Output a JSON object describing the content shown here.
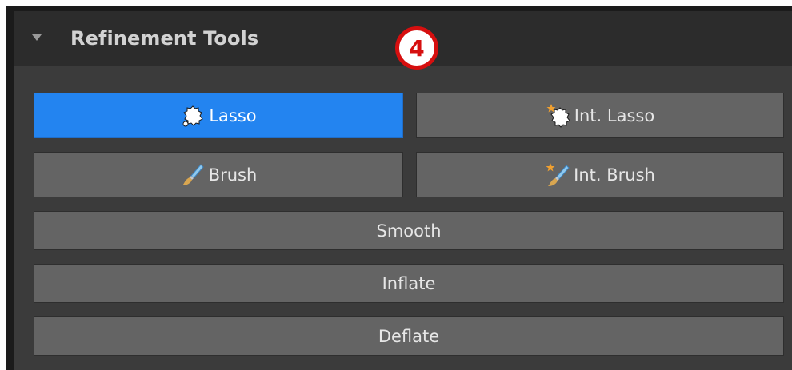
{
  "panel": {
    "title": "Refinement Tools",
    "step_badge": "4"
  },
  "tools": {
    "lasso": {
      "label": "Lasso",
      "icon": "lasso-icon",
      "active": true
    },
    "int_lasso": {
      "label": "Int. Lasso",
      "icon": "int-lasso-icon",
      "active": false
    },
    "brush": {
      "label": "Brush",
      "icon": "brush-icon",
      "active": false
    },
    "int_brush": {
      "label": "Int. Brush",
      "icon": "int-brush-icon",
      "active": false
    },
    "smooth": {
      "label": "Smooth"
    },
    "inflate": {
      "label": "Inflate"
    },
    "deflate": {
      "label": "Deflate"
    }
  },
  "colors": {
    "accent": "#2384f0",
    "badge_ring": "#d60f0f",
    "button_bg": "#646464",
    "panel_bg": "#3b3b3b",
    "header_bg": "#2c2c2c"
  }
}
